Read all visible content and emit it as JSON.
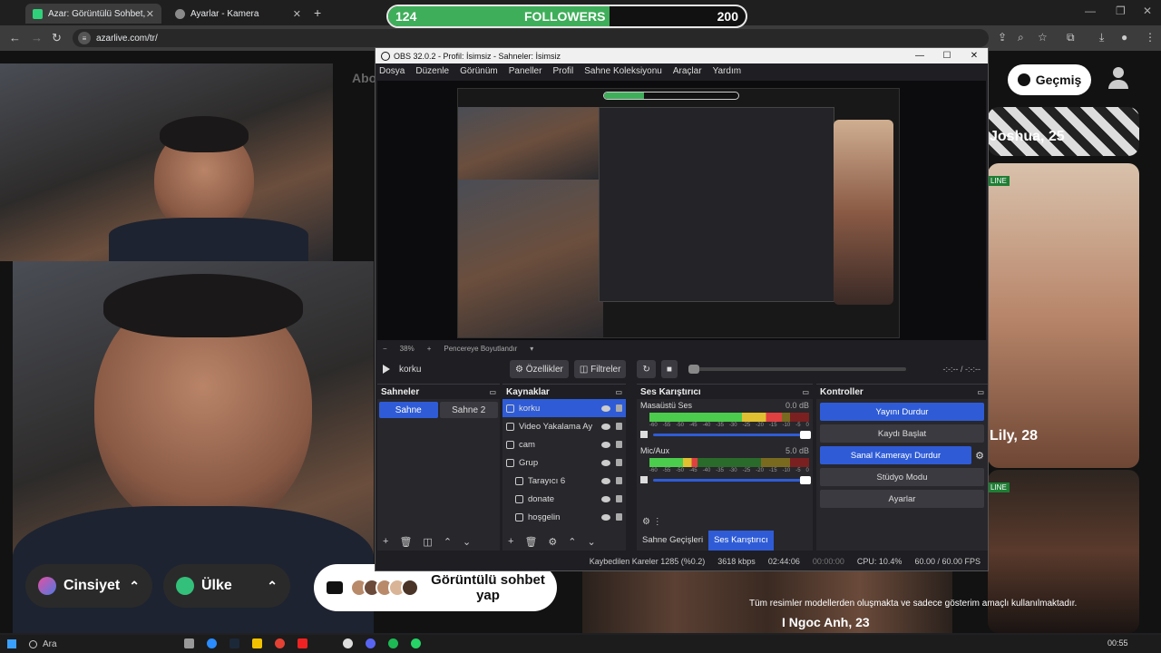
{
  "browser": {
    "tabs": [
      {
        "label": "Azar: Görüntülü Sohbet, Ye",
        "active": true
      },
      {
        "label": "Ayarlar - Kamera",
        "active": false
      }
    ],
    "url": "azarlive.com/tr/"
  },
  "followers_bar": {
    "start": "124",
    "label": "FOLLOWERS",
    "end": "200",
    "progress": 0.62
  },
  "azar": {
    "partial_text": "Abo",
    "gender_pill": "Cinsiyet",
    "country_pill": "Ülke",
    "video_chat_button": "Görüntülü sohbet yap",
    "history_button": "Geçmiş",
    "cards": [
      {
        "name": "Joshua, 25"
      },
      {
        "name": "Lily, 28",
        "badge": "LINE"
      },
      {
        "badge": "LINE"
      }
    ],
    "disclaimer": "Tüm resimler modellerden oluşmakta ve sadece gösterim amaçlı kullanılmaktadır.",
    "bottom_name": "I Ngoc Anh, 23"
  },
  "obs": {
    "title": "OBS 32.0.2 - Profil: İsimsiz - Sahneler: İsimsiz",
    "menu": [
      "Dosya",
      "Düzenle",
      "Görünüm",
      "Paneller",
      "Profil",
      "Sahne Koleksiyonu",
      "Araçlar",
      "Yardım"
    ],
    "zoom": "38%",
    "zoom_mode": "Pencereye Boyutlandır",
    "current_source": "korku",
    "properties_label": "Özellikler",
    "filters_label": "Filtreler",
    "time": "-:-:-- / -:-:--",
    "scenes": {
      "title": "Sahneler",
      "items": [
        {
          "label": "Sahne",
          "active": true
        },
        {
          "label": "Sahne 2",
          "active": false
        }
      ]
    },
    "sources": {
      "title": "Kaynaklar",
      "items": [
        {
          "label": "korku",
          "active": true
        },
        {
          "label": "Video Yakalama Ay"
        },
        {
          "label": "cam"
        },
        {
          "label": "Grup"
        },
        {
          "label": "Tarayıcı 6"
        },
        {
          "label": "donate"
        },
        {
          "label": "hoşgelin"
        }
      ]
    },
    "mixer": {
      "title": "Ses Karıştırıcı",
      "ticks": [
        "-60",
        "-55",
        "-50",
        "-45",
        "-40",
        "-35",
        "-30",
        "-25",
        "-20",
        "-15",
        "-10",
        "-5",
        "0"
      ],
      "channels": [
        {
          "name": "Masaüstü Ses",
          "db": "0.0 dB",
          "level": 0.83
        },
        {
          "name": "Mic/Aux",
          "db": "5.0 dB",
          "level": 0.3
        }
      ]
    },
    "controls": {
      "title": "Kontroller",
      "stop_stream": "Yayını Durdur",
      "start_record": "Kaydı Başlat",
      "stop_virtual_cam": "Sanal Kamerayı Durdur",
      "studio_mode": "Stüdyo Modu",
      "settings": "Ayarlar"
    },
    "dock_tabs": [
      "Sahne Geçişleri",
      "Ses Karıştırıcı"
    ],
    "status": {
      "dropped": "Kaybedilen Kareler 1285 (%0.2)",
      "bitrate": "3618 kbps",
      "stream_time": "02:44:06",
      "record_time": "00:00:00",
      "cpu": "CPU: 10.4%",
      "fps": "60.00 / 60.00 FPS"
    }
  },
  "taskbar": {
    "search": "Ara",
    "time": "00:55"
  }
}
